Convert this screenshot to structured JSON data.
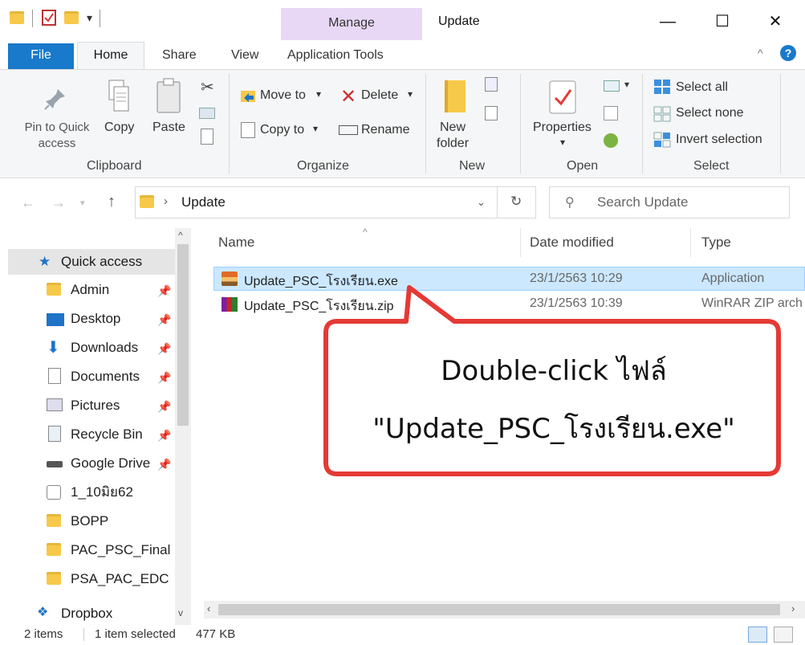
{
  "window": {
    "title": "Update",
    "context_tab": "Manage",
    "controls": {
      "minimize": "—",
      "maximize": "☐",
      "close": "✕"
    }
  },
  "tabs": {
    "file": "File",
    "home": "Home",
    "share": "Share",
    "view": "View",
    "app_tools": "Application Tools"
  },
  "ribbon": {
    "clipboard": {
      "label": "Clipboard",
      "pin_line1": "Pin to Quick",
      "pin_line2": "access",
      "copy": "Copy",
      "paste": "Paste"
    },
    "organize": {
      "label": "Organize",
      "move_to": "Move to",
      "copy_to": "Copy to",
      "delete": "Delete",
      "rename": "Rename"
    },
    "new": {
      "label": "New",
      "new_folder_line1": "New",
      "new_folder_line2": "folder"
    },
    "open": {
      "label": "Open",
      "properties": "Properties"
    },
    "select": {
      "label": "Select",
      "select_all": "Select all",
      "select_none": "Select none",
      "invert": "Invert selection"
    }
  },
  "address": {
    "path": "Update",
    "search_placeholder": "Search Update"
  },
  "nav": {
    "quick_access": "Quick access",
    "items": [
      {
        "label": "Admin",
        "pinned": true
      },
      {
        "label": "Desktop",
        "pinned": true
      },
      {
        "label": "Downloads",
        "pinned": true
      },
      {
        "label": "Documents",
        "pinned": true
      },
      {
        "label": "Pictures",
        "pinned": true
      },
      {
        "label": "Recycle Bin",
        "pinned": true
      },
      {
        "label": "Google Drive",
        "pinned": true
      },
      {
        "label": "1_10มิย62",
        "pinned": false
      },
      {
        "label": "BOPP",
        "pinned": false
      },
      {
        "label": "PAC_PSC_Final",
        "pinned": false
      },
      {
        "label": "PSA_PAC_EDC",
        "pinned": false
      }
    ],
    "dropbox": "Dropbox"
  },
  "files": {
    "columns": {
      "name": "Name",
      "date": "Date modified",
      "type": "Type"
    },
    "rows": [
      {
        "name": "Update_PSC_โรงเรียน.exe",
        "date": "23/1/2563 10:29",
        "type": "Application",
        "selected": true
      },
      {
        "name": "Update_PSC_โรงเรียน.zip",
        "date": "23/1/2563 10:39",
        "type": "WinRAR ZIP arch",
        "selected": false
      }
    ]
  },
  "callout": {
    "line1": "Double-click ไฟล์",
    "line2": "\"Update_PSC_โรงเรียน.exe\"",
    "border_color": "#e53935"
  },
  "status": {
    "items": "2 items",
    "selection": "1 item selected",
    "size": "477 KB"
  },
  "colors": {
    "file_tab": "#1979ca",
    "context_tab": "#e8d8f6",
    "selection": "#cce8ff"
  }
}
